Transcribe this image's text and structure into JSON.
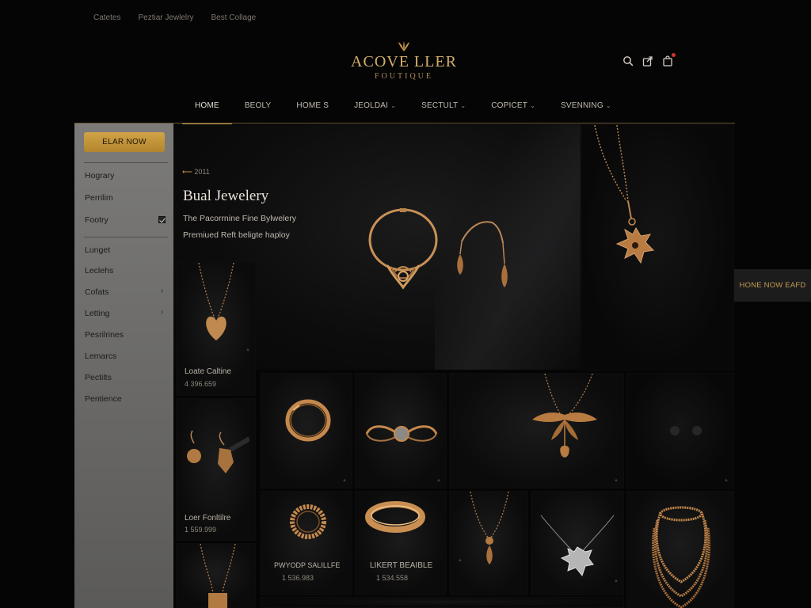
{
  "util_links": [
    "Catetes",
    "Peztiar Jewlelry",
    "Best Collage"
  ],
  "brand": {
    "name": "ACOVE LLER",
    "sub": "FOUTIQUE"
  },
  "nav": [
    {
      "label": "HOME",
      "chevron": false
    },
    {
      "label": "BEOLY",
      "chevron": false
    },
    {
      "label": "HOME S",
      "chevron": false
    },
    {
      "label": "JEOLDAI",
      "chevron": true
    },
    {
      "label": "SECTULT",
      "chevron": true
    },
    {
      "label": "COPICET",
      "chevron": true
    },
    {
      "label": "SVENNING",
      "chevron": true
    }
  ],
  "sidebar": {
    "cta": "ELAR NOW",
    "group1": [
      "Hograry",
      "Perrilim",
      "Footry"
    ],
    "group2": [
      "Lunget",
      "Leclehs",
      "Cofats",
      "Letting",
      "Pesrilrines",
      "Lemarcs",
      "Pectilts",
      "Pentience"
    ]
  },
  "hero": {
    "back": "2011",
    "title": "Bual Jewelery",
    "tagline1": "The Pacorrnine Fine Bylwelery",
    "tagline2": "Premiued Reft beligte haploy"
  },
  "products": [
    {
      "name": "Loate Caltine",
      "price": "4 396.659"
    },
    {
      "name": "Loer Fonltilre",
      "price": "1 559.999"
    },
    {
      "name": "PWYODP SALILLFE",
      "price": "1 536.983"
    },
    {
      "name": "LIKERT BEAIBLE",
      "price": "1 534.558"
    }
  ],
  "side_tab": "HONE NOW EAFD",
  "colors": {
    "gold": "#c09648",
    "cta": "#c89a3e",
    "bg": "#050505",
    "sidebar": "#747371"
  },
  "icons": [
    "search-icon",
    "share-icon",
    "cart-icon"
  ]
}
